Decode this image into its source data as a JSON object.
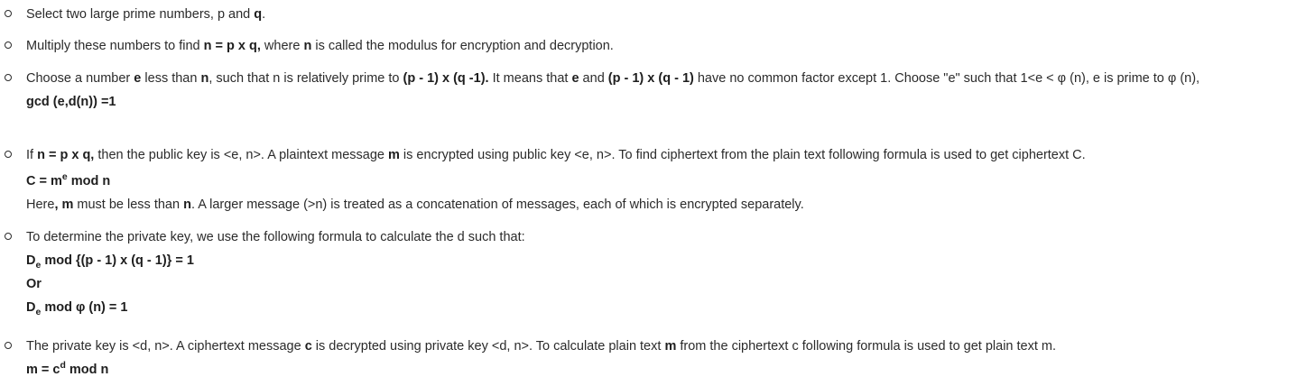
{
  "steps": [
    {
      "t1": "Select two large prime numbers, p and ",
      "b1": "q",
      "t2": "."
    },
    {
      "t1": "Multiply these numbers to find ",
      "b1": "n = p x q,",
      "t2": " where ",
      "b2": "n",
      "t3": " is called the modulus for encryption and decryption."
    },
    {
      "t1": "Choose a number ",
      "b1": "e",
      "t2": " less than ",
      "b2": "n",
      "t3": ", such that n is relatively prime to ",
      "b3": "(p - 1) x (q -1).",
      "t4": " It means that ",
      "b4": "e",
      "t5": " and ",
      "b5": "(p - 1) x (q - 1)",
      "t6": " have no common factor except 1. Choose \"e\" such that 1<e < φ (n), e is prime to φ (n),",
      "gcd": "gcd (e,d(n)) =1"
    },
    {
      "t1": "If ",
      "b1": "n = p x q,",
      "t2": " then the public key is <e, n>. A plaintext message ",
      "b2": "m",
      "t3": " is encrypted using public key <e, n>. To find ciphertext from the plain text following formula is used to get ciphertext C.",
      "formula": {
        "lhs": "C = m",
        "sup": "e",
        "rhs": " mod n"
      },
      "n1": "Here",
      "n1b": ", m",
      "n2": " must be less than ",
      "n2b": "n",
      "n3": ". A larger message (>n) is treated as a concatenation of messages, each of which is encrypted separately."
    },
    {
      "t1": "To determine the private key, we use the following formula to calculate the d such that:",
      "f1": {
        "lhs": "D",
        "sub": "e",
        "rhs": " mod {(p - 1) x (q - 1)} = 1"
      },
      "or": "Or",
      "f2": {
        "lhs": "D",
        "sub": "e",
        "rhs": " mod φ (n) = 1"
      }
    },
    {
      "t1": "The private key is <d, n>. A ciphertext message ",
      "b1": "c",
      "t2": " is decrypted using private key <d, n>. To calculate plain text ",
      "b2": "m",
      "t3": " from the ciphertext c following formula is used to get plain text m.",
      "formula": {
        "lhs": "m = c",
        "sup": "d",
        "rhs": " mod n"
      }
    }
  ]
}
